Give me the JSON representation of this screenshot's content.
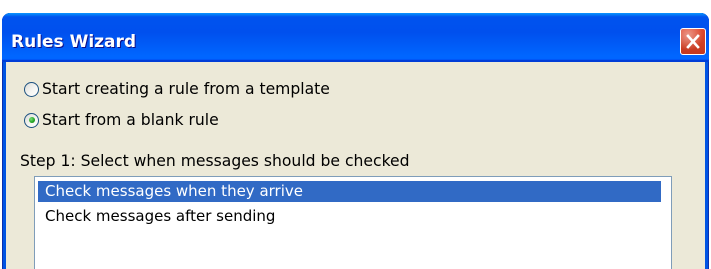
{
  "window": {
    "title": "Rules Wizard",
    "close_icon": "close-icon"
  },
  "options": [
    {
      "label": "Start creating a rule from a template",
      "selected": false
    },
    {
      "label": "Start from a blank rule",
      "selected": true
    }
  ],
  "step": {
    "label": "Step 1: Select when messages should be checked",
    "items": [
      {
        "label": "Check messages when they arrive",
        "selected": true
      },
      {
        "label": "Check messages after sending",
        "selected": false
      }
    ]
  },
  "colors": {
    "window_frame": "#0054E3",
    "dialog_background": "#ECE9D8",
    "selection": "#316AC5",
    "close_button": "#E0472C"
  }
}
